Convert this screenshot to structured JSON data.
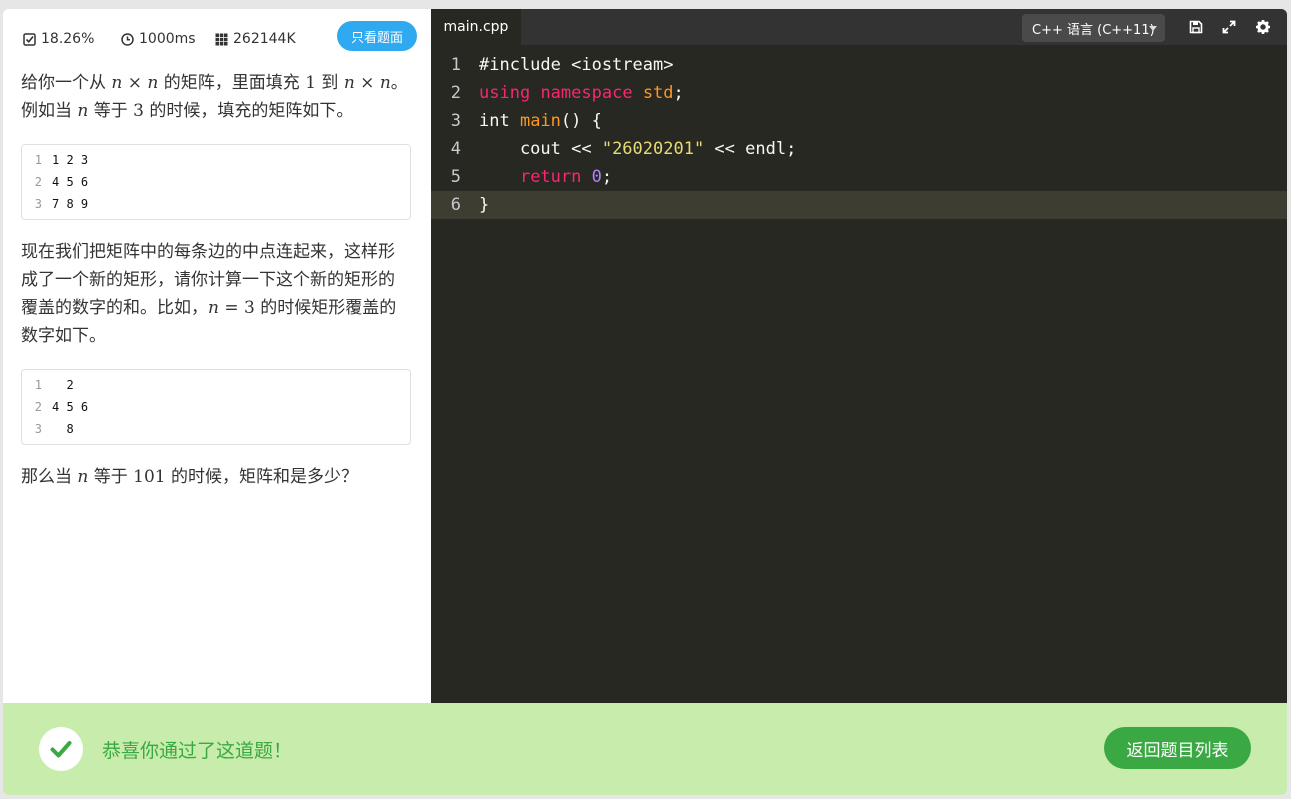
{
  "meta": {
    "pass_rate": "18.26%",
    "time_limit": "1000ms",
    "memory_limit": "262144K",
    "only_problem_label": "只看题面"
  },
  "problem": {
    "p1_a": "给你一个从 ",
    "p1_n1": "n",
    "p1_times1": " × ",
    "p1_n2": "n",
    "p1_b": " 的矩阵，里面填充 ",
    "p1_one": "1",
    "p1_c": " 到 ",
    "p1_n3": "n",
    "p1_times2": " × ",
    "p1_n4": "n",
    "p1_d": "。例如当 ",
    "p1_n5": "n",
    "p1_e": " 等于 ",
    "p1_three": "3",
    "p1_f": " 的时候，填充的矩阵如下。",
    "matrix1": [
      {
        "num": "1",
        "text": "1 2 3"
      },
      {
        "num": "2",
        "text": "4 5 6"
      },
      {
        "num": "3",
        "text": "7 8 9"
      }
    ],
    "p2_a": "现在我们把矩阵中的每条边的中点连起来，这样形成了一个新的矩形，请你计算一下这个新的矩形的覆盖的数字的和。比如，",
    "p2_n": "n",
    "p2_eq": " = ",
    "p2_three": "3",
    "p2_b": " 的时候矩形覆盖的数字如下。",
    "matrix2": [
      {
        "num": "1",
        "text": "  2"
      },
      {
        "num": "2",
        "text": "4 5 6"
      },
      {
        "num": "3",
        "text": "  8"
      }
    ],
    "p3_a": "那么当 ",
    "p3_n": "n",
    "p3_b": " 等于 ",
    "p3_val": "101",
    "p3_c": " 的时候，矩阵和是多少？"
  },
  "editor": {
    "tab": "main.cpp",
    "language": "C++ 语言 (C++11)",
    "lines": [
      {
        "num": "1"
      },
      {
        "num": "2"
      },
      {
        "num": "3"
      },
      {
        "num": "4"
      },
      {
        "num": "5"
      },
      {
        "num": "6"
      }
    ],
    "code": {
      "l1": "#include <iostream>",
      "l2_kw1": "using",
      "l2_kw2": "namespace",
      "l2_std": "std",
      "l2_semi": ";",
      "l3_type": "int ",
      "l3_fn": "main",
      "l3_rest": "() {",
      "l4_a": "    cout << ",
      "l4_str": "\"26020201\"",
      "l4_b": " << endl;",
      "l5_indent": "    ",
      "l5_kw": "return",
      "l5_num": "0",
      "l5_semi": ";",
      "l6": "}"
    }
  },
  "result": {
    "message": "恭喜你通过了这道题！",
    "back_button": "返回题目列表"
  },
  "colors": {
    "accent_blue": "#2fa9f0",
    "success_green": "#3aa943",
    "success_bg": "#c8ecac",
    "editor_bg": "#272822"
  }
}
